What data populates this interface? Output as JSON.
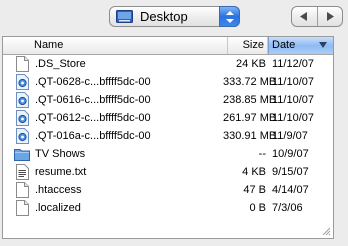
{
  "location": {
    "label": "Desktop",
    "icon": "desktop-folder-icon"
  },
  "nav": {
    "back_icon": "back-arrow-icon",
    "forward_icon": "forward-arrow-icon"
  },
  "columns": {
    "name": "Name",
    "size": "Size",
    "date": "Date"
  },
  "files": [
    {
      "name": ".DS_Store",
      "size": "24 KB",
      "date": "11/12/07",
      "icon": "document-icon"
    },
    {
      "name": ".QT-0628-c...bffff5dc-00",
      "size": "333.72 MB",
      "date": "11/10/07",
      "icon": "quicktime-file-icon"
    },
    {
      "name": ".QT-0616-c...bffff5dc-00",
      "size": "238.85 MB",
      "date": "11/10/07",
      "icon": "quicktime-file-icon"
    },
    {
      "name": ".QT-0612-c...bffff5dc-00",
      "size": "261.97 MB",
      "date": "11/10/07",
      "icon": "quicktime-file-icon"
    },
    {
      "name": ".QT-016a-c...bffff5dc-00",
      "size": "330.91 MB",
      "date": "11/9/07",
      "icon": "quicktime-file-icon"
    },
    {
      "name": "TV Shows",
      "size": "--",
      "date": "10/9/07",
      "icon": "folder-icon"
    },
    {
      "name": "resume.txt",
      "size": "4 KB",
      "date": "9/15/07",
      "icon": "text-file-icon"
    },
    {
      "name": ".htaccess",
      "size": "47 B",
      "date": "4/14/07",
      "icon": "document-icon"
    },
    {
      "name": ".localized",
      "size": "0 B",
      "date": "7/3/06",
      "icon": "document-icon"
    }
  ],
  "colors": {
    "sort_header": "#a9cdf7",
    "popup_accent": "#2a72df",
    "folder": "#6aa6e6"
  }
}
